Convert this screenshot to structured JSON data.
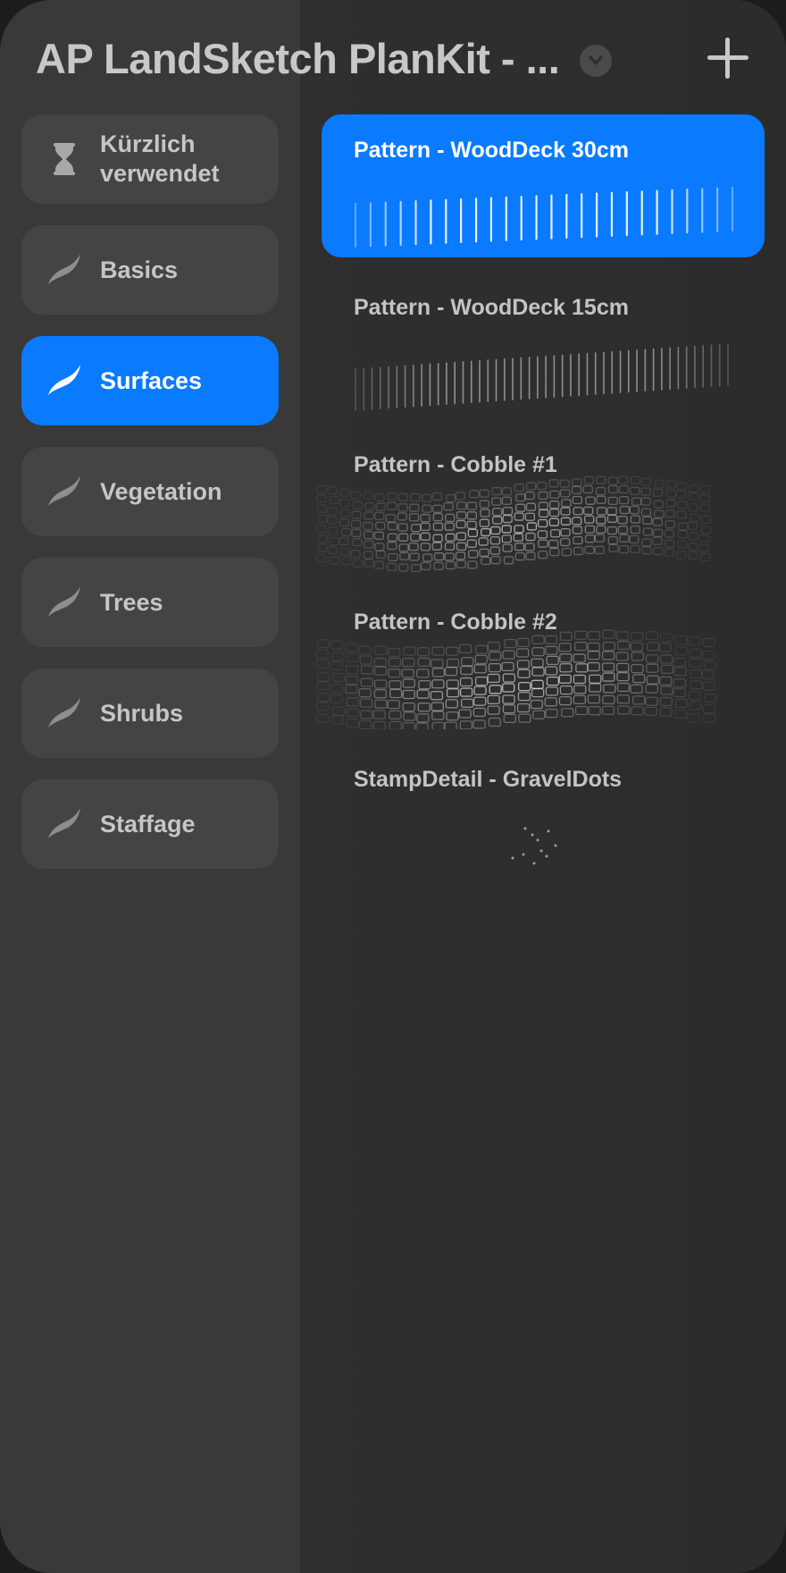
{
  "header": {
    "title": "AP LandSketch PlanKit - ...",
    "chevron_icon": "chevron-down-icon",
    "add_icon": "plus-icon"
  },
  "sidebar": {
    "items": [
      {
        "label": "Kürzlich verwendet",
        "icon": "hourglass-icon",
        "selected": false
      },
      {
        "label": "Basics",
        "icon": "brush-stroke-icon",
        "selected": false
      },
      {
        "label": "Surfaces",
        "icon": "brush-stroke-icon",
        "selected": true
      },
      {
        "label": "Vegetation",
        "icon": "brush-stroke-icon",
        "selected": false
      },
      {
        "label": "Trees",
        "icon": "brush-stroke-icon",
        "selected": false
      },
      {
        "label": "Shrubs",
        "icon": "brush-stroke-icon",
        "selected": false
      },
      {
        "label": "Staffage",
        "icon": "brush-stroke-icon",
        "selected": false
      }
    ]
  },
  "brushes": {
    "items": [
      {
        "name": "Pattern - WoodDeck 30cm",
        "selected": true
      },
      {
        "name": "Pattern - WoodDeck 15cm",
        "selected": false
      },
      {
        "name": "Pattern - Cobble #1",
        "selected": false
      },
      {
        "name": "Pattern - Cobble #2",
        "selected": false
      },
      {
        "name": "StampDetail - GravelDots",
        "selected": false
      }
    ]
  },
  "colors": {
    "accent": "#0a7aff",
    "sidebar_bg": "#393939",
    "content_bg": "#2d2d2d",
    "item_bg": "#444444",
    "text": "#c6c6c6"
  }
}
